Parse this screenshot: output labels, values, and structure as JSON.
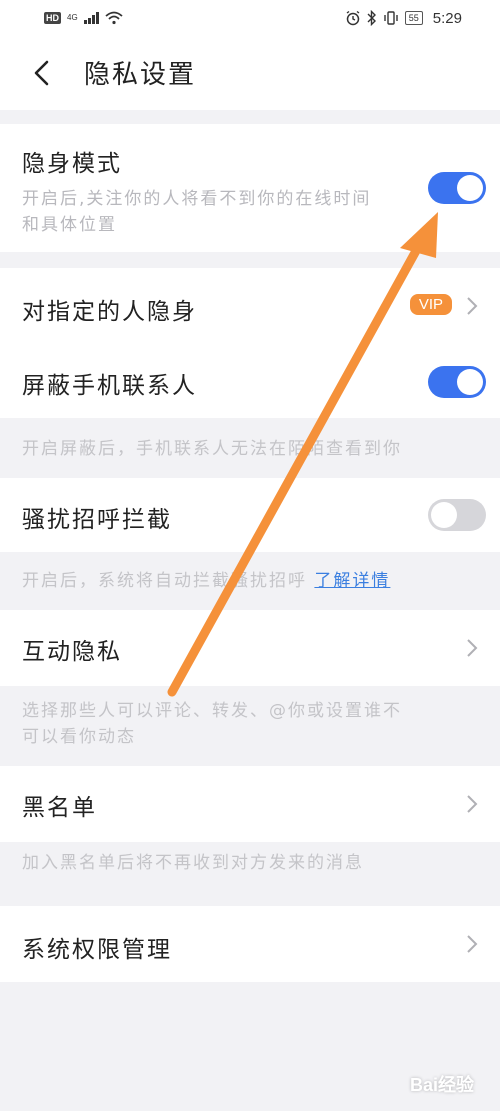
{
  "status_bar": {
    "hd": "HD",
    "network": "4G",
    "battery": "55",
    "time": "5:29",
    "icons": [
      "signal-icon",
      "wifi-icon",
      "alarm-icon",
      "bluetooth-icon",
      "vibrate-icon",
      "battery-icon"
    ]
  },
  "header": {
    "title": "隐私设置",
    "back_icon": "chevron-left-icon"
  },
  "settings": {
    "stealth": {
      "title": "隐身模式",
      "desc_line1": "开启后,关注你的人将看不到你的在线时间",
      "desc_line2": "和具体位置",
      "enabled": true
    },
    "hide_from_specific": {
      "title": "对指定的人隐身",
      "badge": "VIP"
    },
    "block_contacts": {
      "title": "屏蔽手机联系人",
      "enabled": true,
      "note": "开启屏蔽后，手机联系人无法在陌陌查看到你"
    },
    "harassment": {
      "title": "骚扰招呼拦截",
      "enabled": false,
      "note": "开启后，系统将自动拦截骚扰招呼",
      "link": "了解详情"
    },
    "interaction": {
      "title": "互动隐私",
      "note_line1": "选择那些人可以评论、转发、@你或设置谁不",
      "note_line2": "可以看你动态"
    },
    "blacklist": {
      "title": "黑名单",
      "note": "加入黑名单后将不再收到对方发来的消息"
    },
    "permissions": {
      "title": "系统权限管理"
    }
  },
  "annotation": {
    "color": "#f5913a"
  },
  "watermark": {
    "text": "Bai经验"
  },
  "colors": {
    "toggle_on": "#3b73ef",
    "toggle_off": "#d6d6da",
    "vip": "#f5913a",
    "link": "#3b7fe0"
  }
}
